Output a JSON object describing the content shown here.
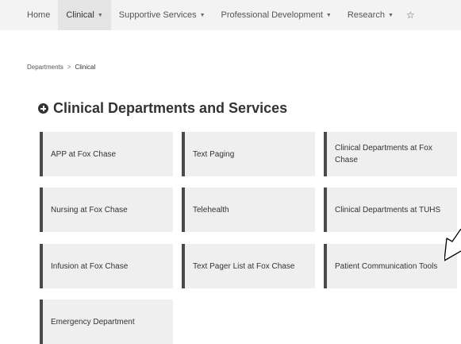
{
  "nav": {
    "items": [
      {
        "label": "Home",
        "dropdown": false
      },
      {
        "label": "Clinical",
        "dropdown": true
      },
      {
        "label": "Supportive Services",
        "dropdown": true
      },
      {
        "label": "Professional Development",
        "dropdown": true
      },
      {
        "label": "Research",
        "dropdown": true
      }
    ],
    "active_index": 1,
    "caret_glyph": "▼",
    "star_icon": "star-outline-icon",
    "star_glyph": "☆"
  },
  "breadcrumb": {
    "parent": "Departments",
    "separator": ">",
    "current": "Clinical"
  },
  "page": {
    "title": "Clinical Departments and Services"
  },
  "cards": [
    {
      "label": "APP at Fox Chase"
    },
    {
      "label": "Text Paging"
    },
    {
      "label": "Clinical Departments at Fox Chase"
    },
    {
      "label": "Nursing at Fox Chase"
    },
    {
      "label": "Telehealth"
    },
    {
      "label": "Clinical Departments at TUHS"
    },
    {
      "label": "Infusion at Fox Chase"
    },
    {
      "label": "Text Pager List at Fox Chase"
    },
    {
      "label": "Patient Communication Tools"
    },
    {
      "label": "Emergency Department"
    }
  ],
  "colors": {
    "nav_bg": "#f3f3f3",
    "card_bg": "#efefef",
    "card_accent": "#4a4a4a",
    "text": "#333333"
  }
}
